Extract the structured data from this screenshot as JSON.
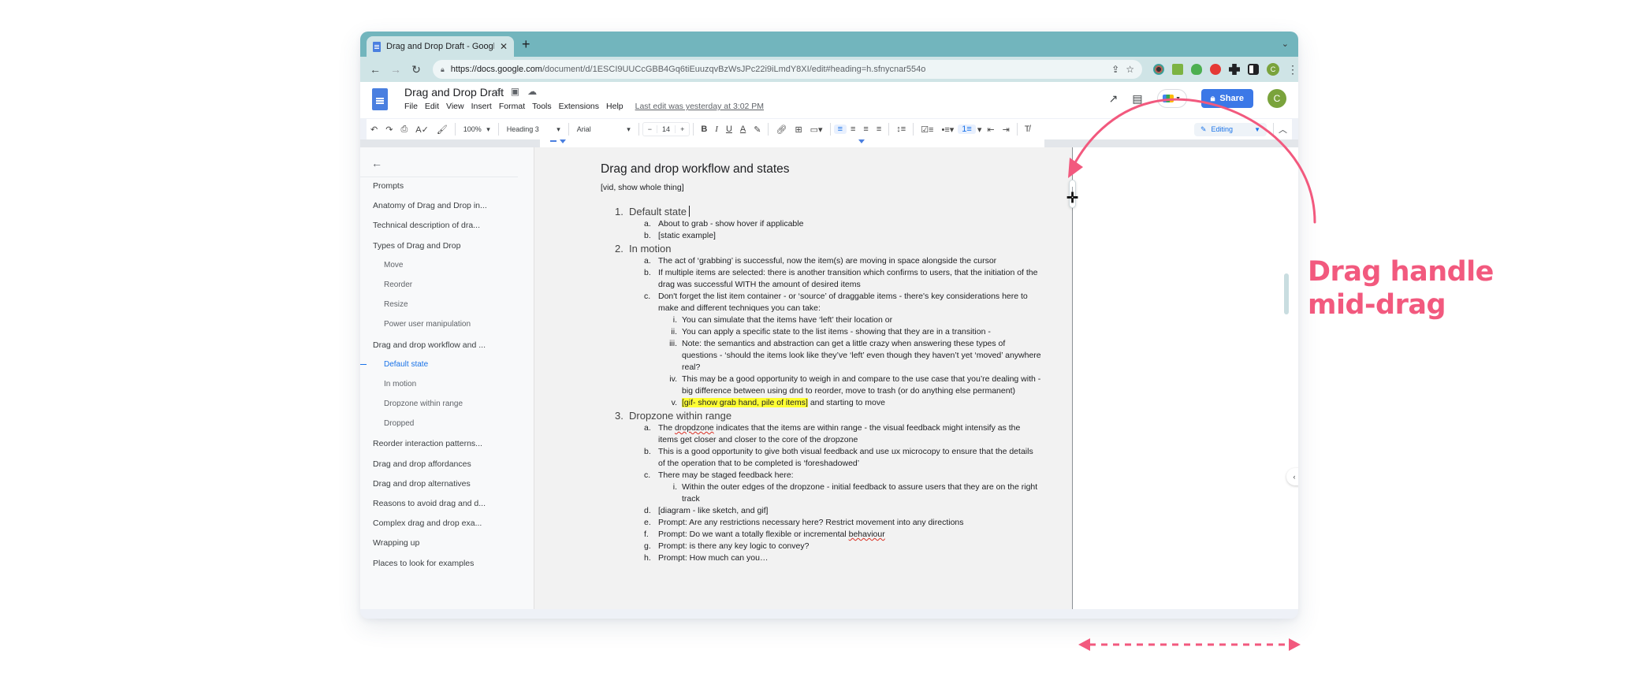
{
  "browser": {
    "tab_title": "Drag and Drop Draft - Google Docs",
    "new_tab_label": "+",
    "url_host": "https://docs.google.com",
    "url_path": "/document/d/1ESCI9UUCcGBB4Gq6tiEuuzqvBzWsJPc22i9iLmdY8XI/edit#heading=h.sfnycnar554o",
    "profile_initial": "C",
    "icons": {
      "back": "arrow-left-icon",
      "forward": "arrow-right-icon",
      "reload": "reload-icon",
      "lock": "lock-icon",
      "share_page": "share-icon",
      "bookmark": "star-icon",
      "menu": "kebab-icon"
    }
  },
  "docs": {
    "title": "Drag and Drop Draft",
    "menu": [
      "File",
      "Edit",
      "View",
      "Insert",
      "Format",
      "Tools",
      "Extensions",
      "Help"
    ],
    "last_edit": "Last edit was yesterday at 3:02 PM",
    "share_label": "Share",
    "avatar_initial": "C",
    "toolbar": {
      "zoom": "100%",
      "style": "Heading 3",
      "font": "Arial",
      "font_size": "14",
      "minus": "−",
      "plus": "+",
      "bold": "B",
      "italic": "I",
      "underline": "U",
      "text_color": "A",
      "mode": "Editing"
    }
  },
  "outline": {
    "items": [
      {
        "label": "Prompts",
        "level": 1
      },
      {
        "label": "Anatomy of Drag and Drop in...",
        "level": 1
      },
      {
        "label": "Technical description of dra...",
        "level": 1
      },
      {
        "label": "Types of Drag and Drop",
        "level": 1
      },
      {
        "label": "Move",
        "level": 2
      },
      {
        "label": "Reorder",
        "level": 2
      },
      {
        "label": "Resize",
        "level": 2
      },
      {
        "label": "Power user manipulation",
        "level": 2
      },
      {
        "label": "Drag and drop workflow and ...",
        "level": 1
      },
      {
        "label": "Default state",
        "level": 2,
        "active": true
      },
      {
        "label": "In motion",
        "level": 2
      },
      {
        "label": "Dropzone within range",
        "level": 2
      },
      {
        "label": "Dropped",
        "level": 2
      },
      {
        "label": "Reorder interaction patterns...",
        "level": 1
      },
      {
        "label": "Drag and drop affordances",
        "level": 1
      },
      {
        "label": "Drag and drop alternatives",
        "level": 1
      },
      {
        "label": "Reasons to avoid drag and d...",
        "level": 1
      },
      {
        "label": "Complex drag and drop exa...",
        "level": 1
      },
      {
        "label": "Wrapping up",
        "level": 1
      },
      {
        "label": "Places to look for examples",
        "level": 1
      }
    ]
  },
  "document": {
    "heading": "Drag and drop workflow and states",
    "intro": "[vid, show whole thing]",
    "s1": {
      "num": "1.",
      "title": "Default state",
      "a": "About to grab - show hover if applicable",
      "b": "[static example]"
    },
    "s2": {
      "num": "2.",
      "title": "In motion",
      "a": "The act of ‘grabbing’ is successful, now the item(s) are moving in space alongside the cursor",
      "b": "If multiple items are selected: there is another transition which confirms to users, that the initiation of the drag was successful WITH the amount of desired items",
      "c": "Don't forget the list item container - or ‘source’ of draggable items - there's key considerations here to make and different techniques you can take:",
      "i": "You can simulate that the items have ‘left’ their location or",
      "ii": "You can apply a specific state to the list items - showing that they are in a transition -",
      "iii": "Note: the semantics and abstraction can get a little crazy when answering these types of questions - ‘should the items look like they’ve ‘left’ even though they haven’t yet ‘moved’ anywhere real?",
      "iv": "This may be a good opportunity to weigh in and compare to the use case that you’re dealing with - big difference between using dnd to reorder, move to trash (or do anything else permanent)",
      "v_highlight": "[gif- show grab hand, pile of items]",
      "v_rest": " and starting to move"
    },
    "s3": {
      "num": "3.",
      "title": "Dropzone within range",
      "a_pre": "The ",
      "a_misspelled": "dropdzone",
      "a_post": " indicates that the items are within range - the visual feedback might intensify as the items get closer and closer to the core of the dropzone",
      "b": "This is a good opportunity to give both visual feedback and use ux microcopy to ensure that the details of the operation that to be completed is ‘foreshadowed’",
      "c": "There may be staged feedback here:",
      "c_i": "Within the outer edges of the dropzone - initial feedback to assure users that they are on the right track",
      "d": "[diagram - like sketch, and gif]",
      "e": "Prompt: Are any restrictions necessary here? Restrict movement into any directions",
      "f_pre": "Prompt: Do we want a totally flexible or incremental ",
      "f_misspelled": "behaviour",
      "g": "Prompt: is there any key logic to convey?",
      "h": "Prompt: How much can you…"
    }
  },
  "annotation": {
    "label_line1": "Drag handle",
    "label_line2": "mid-drag",
    "color": "#f2597e"
  },
  "colors": {
    "tab_strip": "#72b5bd",
    "address_bar": "#cfe4e6",
    "share_button": "#3b78e7",
    "avatar": "#7aa33c",
    "accent": "#1a73e8",
    "highlight": "#ffff33"
  }
}
